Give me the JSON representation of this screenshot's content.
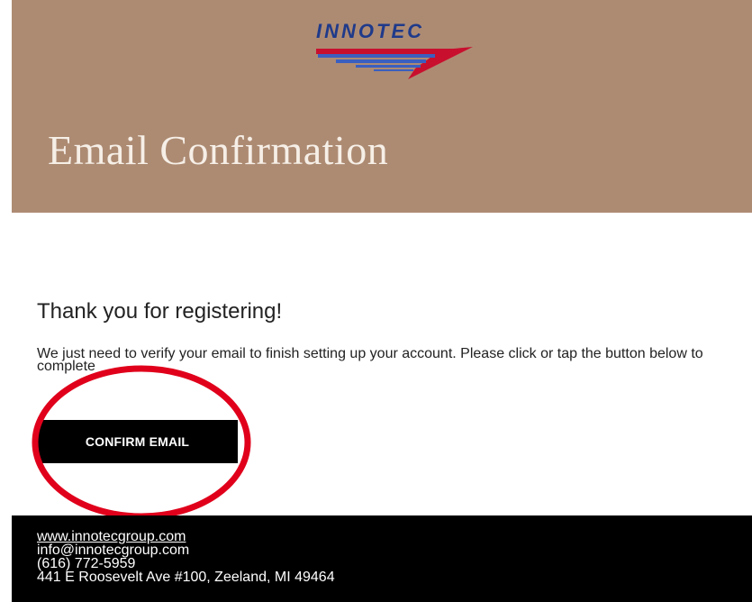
{
  "header": {
    "brand": "INNOTEC",
    "title": "Email Confirmation"
  },
  "main": {
    "thanks": "Thank you for registering!",
    "message": "We just need to verify your email to finish setting up your account. Please click or tap the button below to complete",
    "confirm_label": "CONFIRM EMAIL"
  },
  "footer": {
    "website": "www.innotecgroup.com",
    "email": "info@innotecgroup.com",
    "phone": "(616) 772-5959",
    "address": "441 E Roosevelt Ave #100, Zeeland, MI 49464"
  },
  "colors": {
    "header_bg": "#ad8b73",
    "footer_bg": "#000000",
    "button_bg": "#000000",
    "annotation": "#e0001b",
    "logo_blue": "#1f3a8a",
    "logo_red": "#c8102e"
  },
  "icons": {
    "logo": "innotec-logo-icon"
  }
}
